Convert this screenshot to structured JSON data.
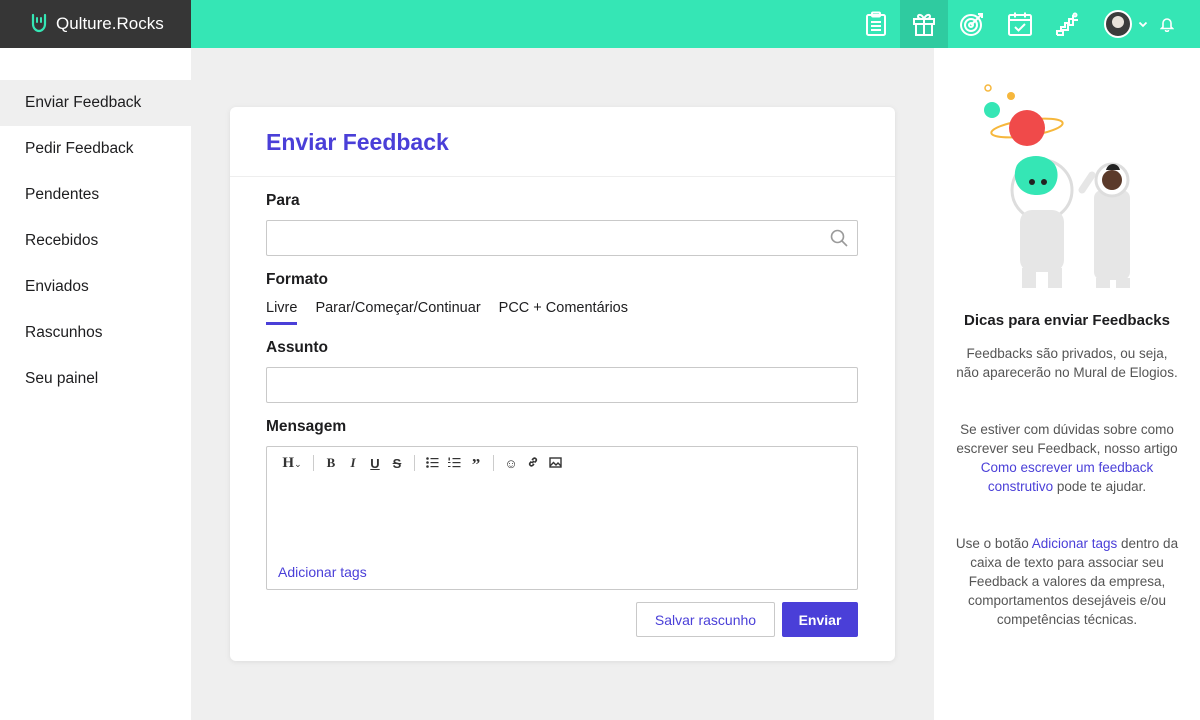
{
  "brand": {
    "name": "Qulture.Rocks"
  },
  "topnav": {
    "icons": [
      "clipboard-icon",
      "gift-icon",
      "target-icon",
      "calendar-check-icon",
      "stairs-icon"
    ],
    "active_index": 1
  },
  "sidebar": {
    "items": [
      {
        "label": "Enviar Feedback",
        "active": true
      },
      {
        "label": "Pedir Feedback"
      },
      {
        "label": "Pendentes"
      },
      {
        "label": "Recebidos"
      },
      {
        "label": "Enviados"
      },
      {
        "label": "Rascunhos"
      },
      {
        "label": "Seu painel"
      }
    ]
  },
  "form": {
    "title": "Enviar Feedback",
    "to_label": "Para",
    "to_value": "",
    "format_label": "Formato",
    "format_tabs": [
      "Livre",
      "Parar/Começar/Continuar",
      "PCC + Comentários"
    ],
    "format_selected": "Livre",
    "subject_label": "Assunto",
    "subject_value": "",
    "message_label": "Mensagem",
    "toolbar": [
      "heading-icon",
      "bold-icon",
      "italic-icon",
      "underline-icon",
      "strikethrough-icon",
      "bullet-list-icon",
      "numbered-list-icon",
      "quote-icon",
      "emoji-icon",
      "link-icon",
      "image-icon"
    ],
    "add_tags": "Adicionar tags",
    "save_draft": "Salvar rascunho",
    "send": "Enviar"
  },
  "tips": {
    "title": "Dicas para enviar Feedbacks",
    "p1": "Feedbacks são privados, ou seja, não aparecerão no Mural de Elogios.",
    "p2_before": "Se estiver com dúvidas sobre como escrever seu Feedback, nosso artigo ",
    "p2_link": "Como escrever um feedback construtivo",
    "p2_after": " pode te ajudar.",
    "p3_before": "Use o botão ",
    "p3_link": "Adicionar tags",
    "p3_after": " dentro da caixa de texto para associar seu Feedback a valores da empresa, comportamentos desejáveis e/ou competências técnicas."
  },
  "colors": {
    "accent": "#4a3fd8",
    "topbar": "#35e6b5",
    "brand_bg": "#363636"
  }
}
